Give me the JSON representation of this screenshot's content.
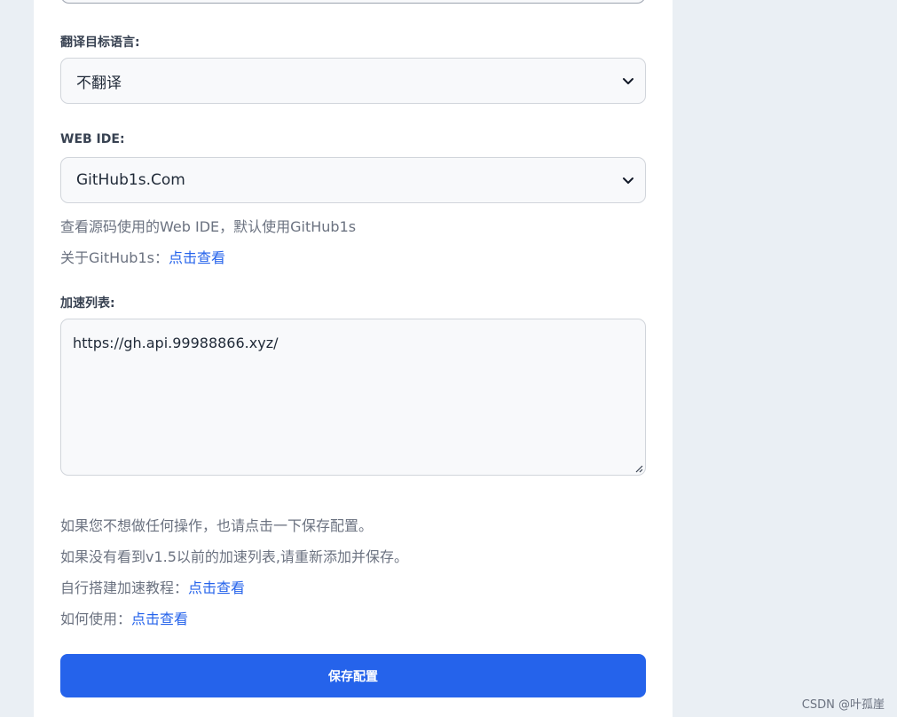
{
  "translate": {
    "label": "翻译目标语言:",
    "selected": "不翻译"
  },
  "webide": {
    "label": "WEB IDE:",
    "selected": "GitHub1s.Com",
    "hint": "查看源码使用的Web IDE，默认使用GitHub1s",
    "about_prefix": "关于GitHub1s：",
    "about_link": "点击查看"
  },
  "accel": {
    "label": "加速列表:",
    "value": "https://gh.api.99988866.xyz/"
  },
  "notes": {
    "line1": "如果您不想做任何操作，也请点击一下保存配置。",
    "line2": "如果没有看到v1.5以前的加速列表,请重新添加并保存。",
    "tutorial_prefix": "自行搭建加速教程：",
    "tutorial_link": "点击查看",
    "usage_prefix": "如何使用：",
    "usage_link": "点击查看"
  },
  "save_label": "保存配置",
  "watermark": "CSDN @叶孤崖",
  "colors": {
    "accent": "#2563eb",
    "background": "#eaeff4",
    "panel": "#ffffff"
  },
  "icons": {
    "select_arrow": "chevron-down-icon",
    "resize": "resize-handle-icon"
  }
}
